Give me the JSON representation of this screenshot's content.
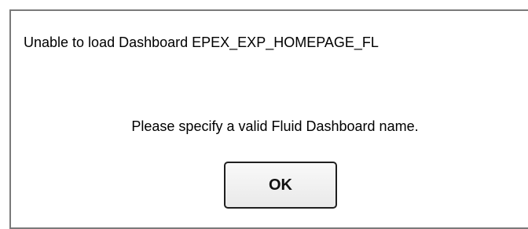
{
  "dialog": {
    "title": "Unable to load Dashboard EPEX_EXP_HOMEPAGE_FL",
    "message": "Please specify a valid Fluid Dashboard name.",
    "ok_label": "OK"
  }
}
